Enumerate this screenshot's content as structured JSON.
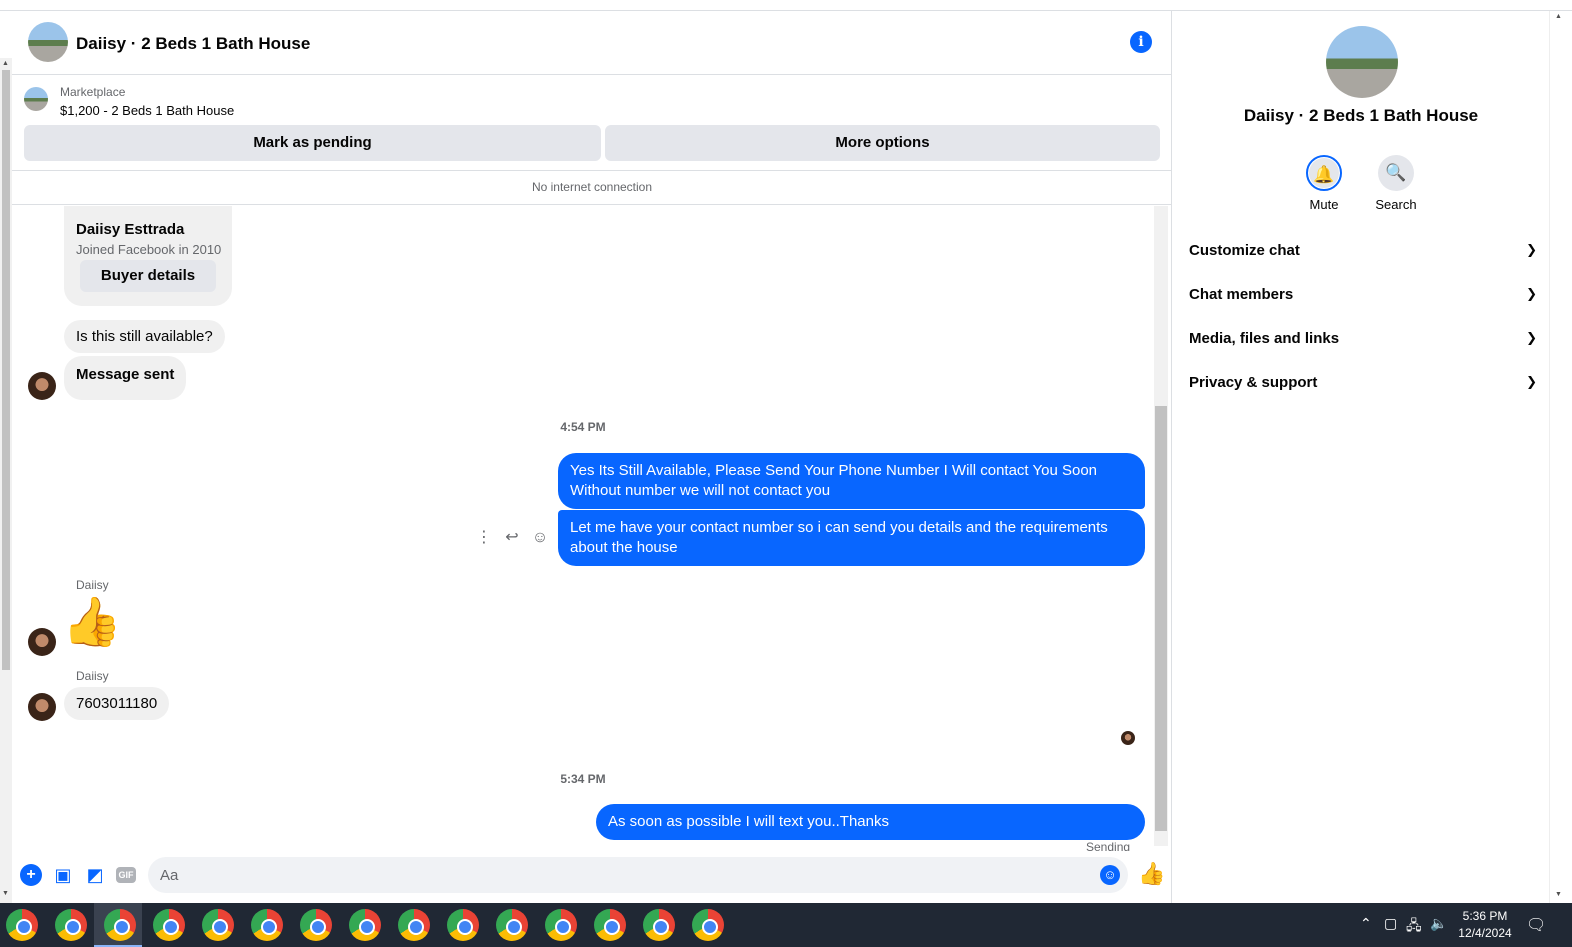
{
  "header": {
    "title": "Daiisy · 2 Beds 1 Bath House",
    "info_icon": "info-icon"
  },
  "marketplace": {
    "label": "Marketplace",
    "listing": "$1,200 - 2 Beds 1 Bath House",
    "pending_label": "Mark as pending",
    "more_label": "More options"
  },
  "status_banner": "No internet connection",
  "buyer_card": {
    "name": "Daiisy Esttrada",
    "joined": "Joined Facebook in 2010",
    "details_label": "Buyer details"
  },
  "messages": {
    "m1": "Is this still available?",
    "m2": "Message sent",
    "time1": "4:54 PM",
    "m3": "Yes Its Still Available, Please Send Your Phone Number I Will contact  You Soon Without number we will not contact you",
    "m4": "Let me have your contact number so i can send you details and the requirements about the house",
    "sender1": "Daiisy",
    "sender2": "Daiisy",
    "m5": "7603011180",
    "time2": "5:34 PM",
    "m6": "As soon as possible I will text you..Thanks",
    "m6_status": "Sending"
  },
  "composer": {
    "placeholder": "Aa"
  },
  "sidebar": {
    "title": "Daiisy · 2 Beds 1 Bath House",
    "mute_label": "Mute",
    "search_label": "Search",
    "rows": [
      {
        "label": "Customize chat"
      },
      {
        "label": "Chat members"
      },
      {
        "label": "Media, files and links"
      },
      {
        "label": "Privacy & support"
      }
    ]
  },
  "taskbar": {
    "time": "5:36 PM",
    "date": "12/4/2024"
  },
  "colors": {
    "accent": "#0866ff",
    "bubble_in": "#f0f0f0",
    "taskbar": "#202834"
  }
}
